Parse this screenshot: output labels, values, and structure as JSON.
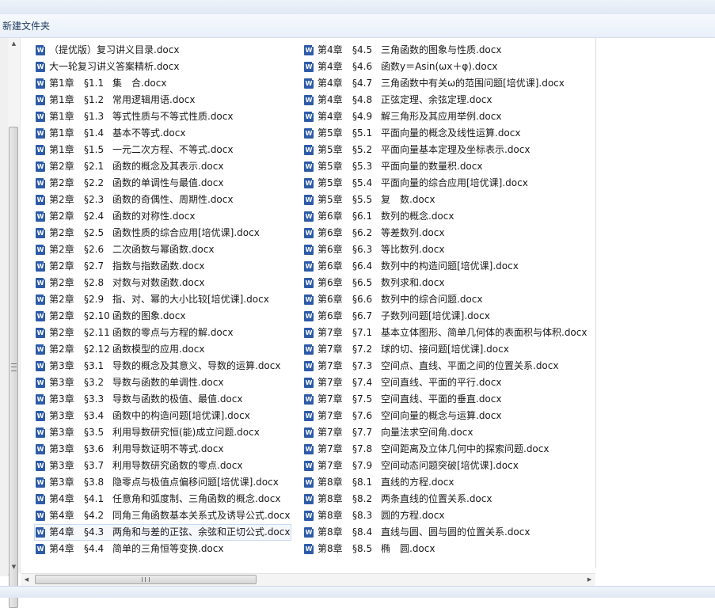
{
  "window": {
    "title": "新建文件夹"
  },
  "files_col1": [
    {
      "icon": "W",
      "ch": "",
      "sec": "",
      "name": "（提优版）复习讲义目录.docx"
    },
    {
      "icon": "W",
      "ch": "",
      "sec": "",
      "name": "大一轮复习讲义答案精析.docx"
    },
    {
      "icon": "W",
      "ch": "第1章",
      "sec": "§1.1",
      "name": "集　合.docx"
    },
    {
      "icon": "W",
      "ch": "第1章",
      "sec": "§1.2",
      "name": "常用逻辑用语.docx"
    },
    {
      "icon": "W",
      "ch": "第1章",
      "sec": "§1.3",
      "name": "等式性质与不等式性质.docx"
    },
    {
      "icon": "W",
      "ch": "第1章",
      "sec": "§1.4",
      "name": "基本不等式.docx"
    },
    {
      "icon": "W",
      "ch": "第1章",
      "sec": "§1.5",
      "name": "一元二次方程、不等式.docx"
    },
    {
      "icon": "W",
      "ch": "第2章",
      "sec": "§2.1",
      "name": "函数的概念及其表示.docx"
    },
    {
      "icon": "W",
      "ch": "第2章",
      "sec": "§2.2",
      "name": "函数的单调性与最值.docx"
    },
    {
      "icon": "W",
      "ch": "第2章",
      "sec": "§2.3",
      "name": "函数的奇偶性、周期性.docx"
    },
    {
      "icon": "W",
      "ch": "第2章",
      "sec": "§2.4",
      "name": "函数的对称性.docx"
    },
    {
      "icon": "W",
      "ch": "第2章",
      "sec": "§2.5",
      "name": "函数性质的综合应用[培优课].docx"
    },
    {
      "icon": "W",
      "ch": "第2章",
      "sec": "§2.6",
      "name": "二次函数与幂函数.docx"
    },
    {
      "icon": "W",
      "ch": "第2章",
      "sec": "§2.7",
      "name": "指数与指数函数.docx"
    },
    {
      "icon": "W",
      "ch": "第2章",
      "sec": "§2.8",
      "name": "对数与对数函数.docx"
    },
    {
      "icon": "W",
      "ch": "第2章",
      "sec": "§2.9",
      "name": "指、对、幂的大小比较[培优课].docx"
    },
    {
      "icon": "W",
      "ch": "第2章",
      "sec": "§2.10",
      "name": "函数的图象.docx"
    },
    {
      "icon": "W",
      "ch": "第2章",
      "sec": "§2.11",
      "name": "函数的零点与方程的解.docx"
    },
    {
      "icon": "W",
      "ch": "第2章",
      "sec": "§2.12",
      "name": "函数模型的应用.docx"
    },
    {
      "icon": "W",
      "ch": "第3章",
      "sec": "§3.1",
      "name": "导数的概念及其意义、导数的运算.docx"
    },
    {
      "icon": "W",
      "ch": "第3章",
      "sec": "§3.2",
      "name": "导数与函数的单调性.docx"
    },
    {
      "icon": "W",
      "ch": "第3章",
      "sec": "§3.3",
      "name": "导数与函数的极值、最值.docx"
    },
    {
      "icon": "W",
      "ch": "第3章",
      "sec": "§3.4",
      "name": "函数中的构造问题[培优课].docx"
    },
    {
      "icon": "W",
      "ch": "第3章",
      "sec": "§3.5",
      "name": "利用导数研究恒(能)成立问题.docx"
    },
    {
      "icon": "W",
      "ch": "第3章",
      "sec": "§3.6",
      "name": "利用导数证明不等式.docx"
    },
    {
      "icon": "W",
      "ch": "第3章",
      "sec": "§3.7",
      "name": "利用导数研究函数的零点.docx"
    },
    {
      "icon": "W",
      "ch": "第3章",
      "sec": "§3.8",
      "name": "隐零点与极值点偏移问题[培优课].docx"
    },
    {
      "icon": "W",
      "ch": "第4章",
      "sec": "§4.1",
      "name": "任意角和弧度制、三角函数的概念.docx"
    },
    {
      "icon": "W",
      "ch": "第4章",
      "sec": "§4.2",
      "name": "同角三角函数基本关系式及诱导公式.docx"
    },
    {
      "icon": "W",
      "ch": "第4章",
      "sec": "§4.3",
      "name": "两角和与差的正弦、余弦和正切公式.docx"
    },
    {
      "icon": "W",
      "ch": "第4章",
      "sec": "§4.4",
      "name": "简单的三角恒等变换.docx"
    }
  ],
  "files_col2": [
    {
      "icon": "W",
      "ch": "第4章",
      "sec": "§4.5",
      "name": "三角函数的图象与性质.docx"
    },
    {
      "icon": "W",
      "ch": "第4章",
      "sec": "§4.6",
      "name": "函数y＝Asin(ωx＋φ).docx"
    },
    {
      "icon": "W",
      "ch": "第4章",
      "sec": "§4.7",
      "name": "三角函数中有关ω的范围问题[培优课].docx"
    },
    {
      "icon": "W",
      "ch": "第4章",
      "sec": "§4.8",
      "name": "正弦定理、余弦定理.docx"
    },
    {
      "icon": "W",
      "ch": "第4章",
      "sec": "§4.9",
      "name": "解三角形及其应用举例.docx"
    },
    {
      "icon": "W",
      "ch": "第5章",
      "sec": "§5.1",
      "name": "平面向量的概念及线性运算.docx"
    },
    {
      "icon": "W",
      "ch": "第5章",
      "sec": "§5.2",
      "name": "平面向量基本定理及坐标表示.docx"
    },
    {
      "icon": "W",
      "ch": "第5章",
      "sec": "§5.3",
      "name": "平面向量的数量积.docx"
    },
    {
      "icon": "W",
      "ch": "第5章",
      "sec": "§5.4",
      "name": "平面向量的综合应用[培优课].docx"
    },
    {
      "icon": "W",
      "ch": "第5章",
      "sec": "§5.5",
      "name": "复　数.docx"
    },
    {
      "icon": "W",
      "ch": "第6章",
      "sec": "§6.1",
      "name": "数列的概念.docx"
    },
    {
      "icon": "W",
      "ch": "第6章",
      "sec": "§6.2",
      "name": "等差数列.docx"
    },
    {
      "icon": "W",
      "ch": "第6章",
      "sec": "§6.3",
      "name": "等比数列.docx"
    },
    {
      "icon": "W",
      "ch": "第6章",
      "sec": "§6.4",
      "name": "数列中的构造问题[培优课].docx"
    },
    {
      "icon": "W",
      "ch": "第6章",
      "sec": "§6.5",
      "name": "数列求和.docx"
    },
    {
      "icon": "W",
      "ch": "第6章",
      "sec": "§6.6",
      "name": "数列中的综合问题.docx"
    },
    {
      "icon": "W",
      "ch": "第6章",
      "sec": "§6.7",
      "name": "子数列问题[培优课].docx"
    },
    {
      "icon": "W",
      "ch": "第7章",
      "sec": "§7.1",
      "name": "基本立体图形、简单几何体的表面积与体积.docx"
    },
    {
      "icon": "W",
      "ch": "第7章",
      "sec": "§7.2",
      "name": "球的切、接问题[培优课].docx"
    },
    {
      "icon": "W",
      "ch": "第7章",
      "sec": "§7.3",
      "name": "空间点、直线、平面之间的位置关系.docx"
    },
    {
      "icon": "W",
      "ch": "第7章",
      "sec": "§7.4",
      "name": "空间直线、平面的平行.docx"
    },
    {
      "icon": "W",
      "ch": "第7章",
      "sec": "§7.5",
      "name": "空间直线、平面的垂直.docx"
    },
    {
      "icon": "W",
      "ch": "第7章",
      "sec": "§7.6",
      "name": "空间向量的概念与运算.docx"
    },
    {
      "icon": "W",
      "ch": "第7章",
      "sec": "§7.7",
      "name": "向量法求空间角.docx"
    },
    {
      "icon": "W",
      "ch": "第7章",
      "sec": "§7.8",
      "name": "空间距离及立体几何中的探索问题.docx"
    },
    {
      "icon": "W",
      "ch": "第7章",
      "sec": "§7.9",
      "name": "空间动态问题突破[培优课].docx"
    },
    {
      "icon": "W",
      "ch": "第8章",
      "sec": "§8.1",
      "name": "直线的方程.docx"
    },
    {
      "icon": "W",
      "ch": "第8章",
      "sec": "§8.2",
      "name": "两条直线的位置关系.docx"
    },
    {
      "icon": "W",
      "ch": "第8章",
      "sec": "§8.3",
      "name": "圆的方程.docx"
    },
    {
      "icon": "W",
      "ch": "第8章",
      "sec": "§8.4",
      "name": "直线与圆、圆与圆的位置关系.docx"
    },
    {
      "icon": "W",
      "ch": "第8章",
      "sec": "§8.5",
      "name": "椭　圆.docx"
    }
  ],
  "selected_index_col1": 29,
  "scrollbars": {
    "up": "▲",
    "down": "▼",
    "left": "◀",
    "right": "▶"
  }
}
